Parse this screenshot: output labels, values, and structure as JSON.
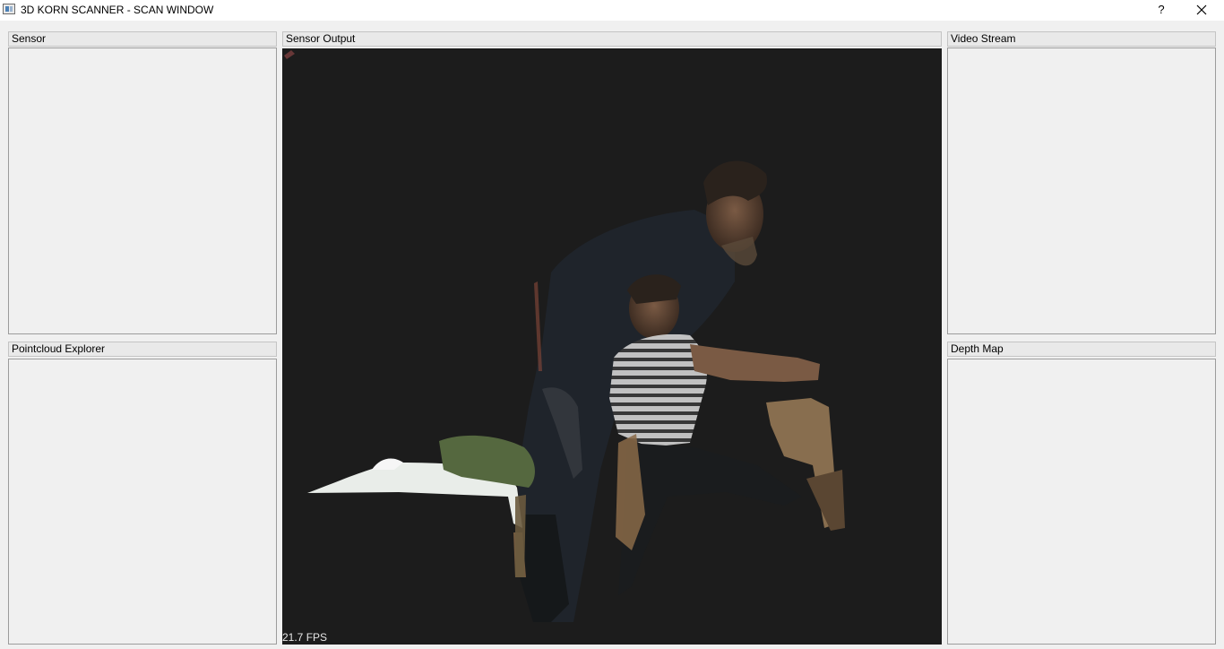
{
  "window": {
    "title": "3D KORN SCANNER - SCAN WINDOW",
    "help_label": "?",
    "icons": {
      "app": "app-window-icon",
      "close": "close-icon"
    }
  },
  "panels": {
    "sensor": {
      "label": "Sensor"
    },
    "sensor_output": {
      "label": "Sensor Output",
      "fps": "21.7 FPS"
    },
    "video_stream": {
      "label": "Video Stream"
    },
    "pointcloud_explorer": {
      "label": "Pointcloud Explorer"
    },
    "depth_map": {
      "label": "Depth Map"
    }
  },
  "colors": {
    "viewport_bg": "#1c1c1c",
    "panel_bg": "#f0f0f0",
    "header_bg": "#e9e9e9"
  }
}
